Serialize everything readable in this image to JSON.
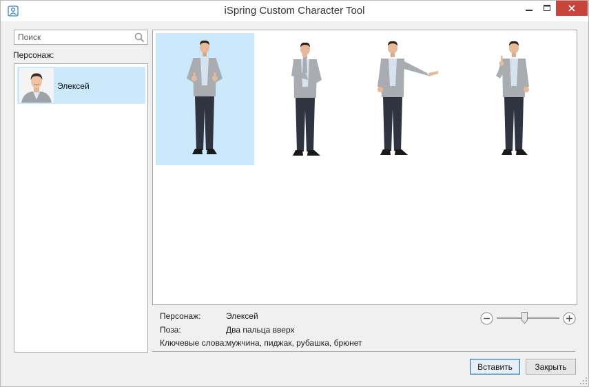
{
  "window": {
    "title": "iSpring Custom Character Tool",
    "app_icon": "person-icon",
    "controls": [
      "minimize-icon",
      "maximize-icon",
      "close-icon"
    ]
  },
  "sidebar": {
    "search": {
      "value": "",
      "placeholder": "Поиск",
      "icon": "search-icon"
    },
    "characters_label": "Персонаж:",
    "characters": [
      {
        "name": "Элексей",
        "selected": true
      }
    ]
  },
  "poses": [
    {
      "pose": "thumbs-up",
      "selected": true
    },
    {
      "pose": "thinking",
      "selected": false
    },
    {
      "pose": "presenting",
      "selected": false
    },
    {
      "pose": "finger-up",
      "selected": false
    }
  ],
  "details": {
    "character_label": "Персонаж:",
    "character_value": "Элексей",
    "pose_label": "Поза:",
    "pose_value": "Два пальца вверх",
    "keywords_label": "Ключевые слова:",
    "keywords_value": "мужчина, пиджак, рубашка, брюнет"
  },
  "zoom": {
    "level": 0.45,
    "minus_icon": "zoom-out-icon",
    "plus_icon": "zoom-in-icon"
  },
  "buttons": {
    "insert": "Вставить",
    "close": "Закрыть"
  },
  "colors": {
    "selection": "#cce8fb",
    "close_button": "#c7453a",
    "accent": "#3c7fb1"
  }
}
